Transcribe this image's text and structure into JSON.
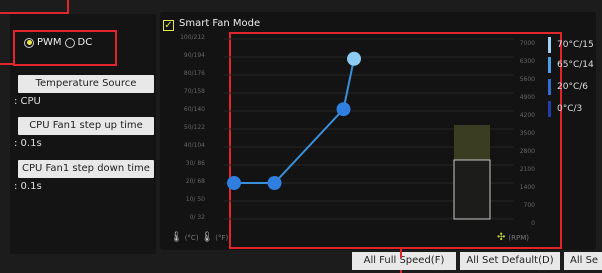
{
  "fan_mode": {
    "pwm_label": "PWM",
    "dc_label": "DC",
    "selected": "PWM"
  },
  "temperature_source": {
    "button_label": "Temperature Source",
    "value": ": CPU"
  },
  "step_up": {
    "button_label": "CPU Fan1 step up time",
    "value": ": 0.1s"
  },
  "step_down": {
    "button_label": "CPU Fan1 step down time",
    "value": ": 0.1s"
  },
  "smart_fan": {
    "checkbox_label": "Smart Fan Mode",
    "checked": true
  },
  "graph": {
    "temp_ticks": [
      "100/212",
      "90/194",
      "80/176",
      "70/158",
      "60/140",
      "50/122",
      "40/104",
      "30/ 86",
      "20/ 68",
      "10/ 50",
      "0/ 32"
    ],
    "rpm_ticks": [
      "7000",
      "6300",
      "5600",
      "4900",
      "4200",
      "3500",
      "2800",
      "2100",
      "1400",
      "700",
      "0"
    ],
    "temp_unit_c": "(°C)",
    "temp_unit_f": "(°F)",
    "rpm_unit": "(RPM)",
    "thermometer_icon": "thermometer-icon",
    "fan_icon": "fan-icon",
    "curve_points_pct": [
      [
        0,
        20
      ],
      [
        27,
        20
      ],
      [
        73,
        61
      ],
      [
        80,
        89
      ]
    ],
    "line_color": "#3a8fd8",
    "point_color": "#2f7ee0",
    "highlight_point_color": "#8ecbf2"
  },
  "legend": [
    {
      "label": "70°C/15",
      "color": "#9fd4f7"
    },
    {
      "label": "65°C/14",
      "color": "#4aa1ea"
    },
    {
      "label": "20°C/6",
      "color": "#2f6ed6"
    },
    {
      "label": "0°C/3",
      "color": "#1f3ea8"
    }
  ],
  "bottom_buttons": {
    "full_speed": "All Full Speed(F)",
    "set_default": "All Set Default(D)",
    "set_cancel": "All Se"
  }
}
